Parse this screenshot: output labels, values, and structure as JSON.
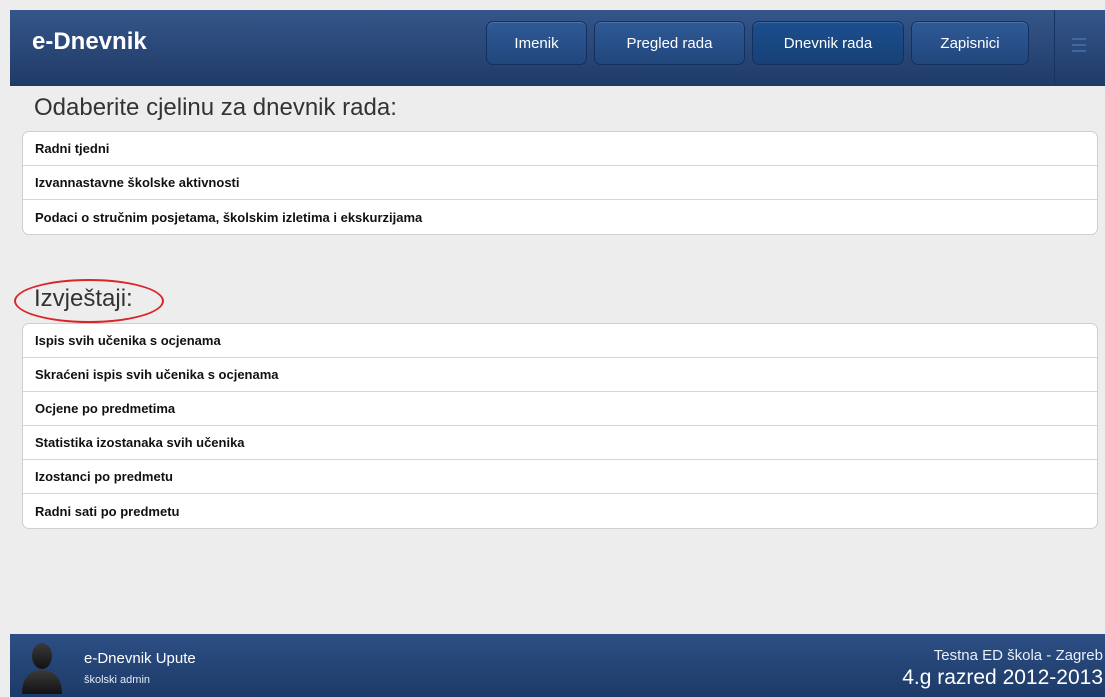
{
  "header": {
    "brand": "e-Dnevnik",
    "nav": [
      {
        "label": "Imenik"
      },
      {
        "label": "Pregled rada"
      },
      {
        "label": "Dnevnik rada"
      },
      {
        "label": "Zapisnici"
      }
    ],
    "active_nav": "Dnevnik rada",
    "menu_icon": "hamburger-menu-icon"
  },
  "section_work": {
    "title": "Odaberite cjelinu za dnevnik rada:",
    "items": [
      {
        "label": "Radni tjedni"
      },
      {
        "label": "Izvannastavne školske aktivnosti"
      },
      {
        "label": "Podaci o stručnim posjetama, školskim izletima i ekskurzijama"
      }
    ]
  },
  "section_reports": {
    "title": "Izvještaji:",
    "items": [
      {
        "label": "Ispis svih učenika s ocjenama"
      },
      {
        "label": "Skraćeni ispis svih učenika s ocjenama"
      },
      {
        "label": "Ocjene po predmetima"
      },
      {
        "label": "Statistika izostanaka svih učenika"
      },
      {
        "label": "Izostanci po predmetu"
      },
      {
        "label": "Radni sati po predmetu"
      }
    ]
  },
  "footer": {
    "title": "e-Dnevnik Upute",
    "role": "školski admin",
    "school": "Testna ED škola - Zagreb",
    "class": "4.g razred 2012-2013",
    "avatar_icon": "user-silhouette-icon"
  },
  "colors": {
    "header_bg": "#2a4a7d",
    "annotation": "#d8262b",
    "page_bg": "#ededed"
  }
}
